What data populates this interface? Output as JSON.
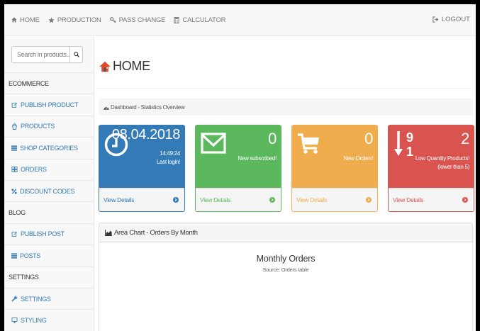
{
  "navbar": {
    "items": [
      {
        "label": "HOME",
        "icon": "home-icon"
      },
      {
        "label": "PRODUCTION",
        "icon": "star-icon"
      },
      {
        "label": "PASS CHANGE",
        "icon": "key-icon"
      },
      {
        "label": "CALCULATOR",
        "icon": "calculator-icon"
      }
    ],
    "logout": {
      "label": "LOGOUT",
      "icon": "sign-out-icon"
    }
  },
  "sidebar": {
    "search": {
      "placeholder": "Search in products...",
      "icon": "search-icon"
    },
    "items": [
      {
        "label": "ECOMMERCE",
        "type": "header"
      },
      {
        "label": "PUBLISH PRODUCT",
        "icon": "edit-icon"
      },
      {
        "label": "PRODUCTS",
        "icon": "product-icon"
      },
      {
        "label": "SHOP CATEGORIES",
        "icon": "list-icon"
      },
      {
        "label": "ORDERS",
        "icon": "orders-icon"
      },
      {
        "label": "DISCOUNT CODES",
        "icon": "percent-icon"
      },
      {
        "label": "BLOG",
        "type": "header"
      },
      {
        "label": "PUBLISH POST",
        "icon": "edit-icon"
      },
      {
        "label": "POSTS",
        "icon": "list-icon"
      },
      {
        "label": "SETTINGS",
        "type": "header"
      },
      {
        "label": "SETTINGS",
        "icon": "wrench-icon"
      },
      {
        "label": "STYLING",
        "icon": "desktop-icon"
      }
    ]
  },
  "page": {
    "title": "HOME",
    "breadcrumb": "Dashboard - Statistics Overview"
  },
  "panels": [
    {
      "big": "08.04.2018",
      "line1": "14:49:24",
      "line2": "Last login!",
      "footer": "View Details",
      "color": "#337ab7",
      "icon": "clock-icon"
    },
    {
      "big": "0",
      "line1": "New subscribed!",
      "footer": "View Details",
      "color": "#5cb85c",
      "icon": "envelope-icon"
    },
    {
      "big": "0",
      "line1": "New Orders!",
      "footer": "View Details",
      "color": "#f0ad4e",
      "icon": "shopping-cart-icon"
    },
    {
      "big": "2",
      "line1": "Low Quantity Products!",
      "line2": "(lower than 5)",
      "footer": "View Details",
      "color": "#d9534f",
      "icon": "sort-numeric-desc-icon"
    }
  ],
  "chart": {
    "heading": "Area Chart - Orders By Month",
    "title": "Monthly Orders",
    "subtitle": "Source: Orders table"
  }
}
